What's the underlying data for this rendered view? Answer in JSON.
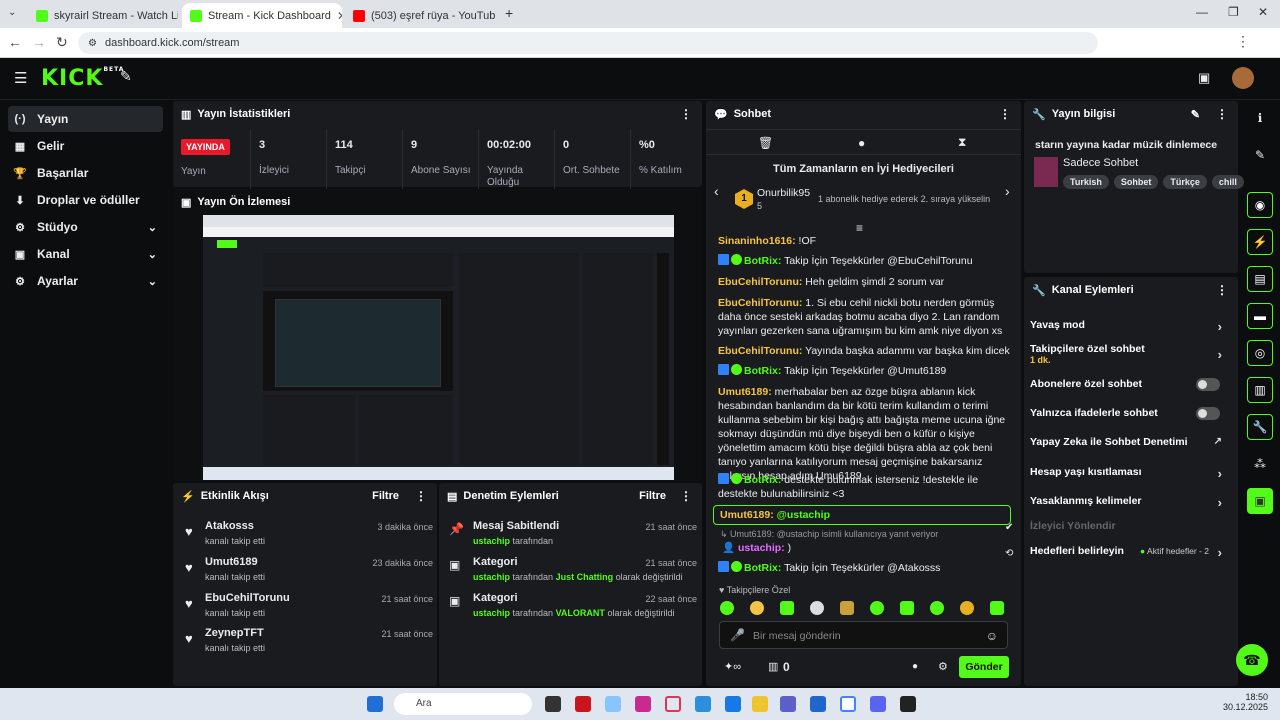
{
  "browser": {
    "tabs": [
      {
        "title": "skyrairl Stream - Watch Live on",
        "color": "#53fc18"
      },
      {
        "title": "Stream - Kick Dashboard",
        "color": "#53fc18"
      },
      {
        "title": "(503) eşref rüya - YouTube",
        "color": "#ff0000"
      }
    ],
    "url": "dashboard.kick.com/stream"
  },
  "header": {
    "logo": "KICK",
    "beta": "BETA"
  },
  "sidebar": {
    "items": [
      {
        "label": "Yayın",
        "icon": "(·)"
      },
      {
        "label": "Gelir",
        "icon": "▦"
      },
      {
        "label": "Başarılar",
        "icon": "🏆"
      },
      {
        "label": "Droplar ve ödüller",
        "icon": "⬇"
      },
      {
        "label": "Stüdyo",
        "icon": "⚙"
      },
      {
        "label": "Kanal",
        "icon": "▣"
      },
      {
        "label": "Ayarlar",
        "icon": "⚙"
      }
    ]
  },
  "stats": {
    "title": "Yayın İstatistikleri",
    "live": "YAYINDA",
    "live_label": "Yayın",
    "items": [
      {
        "value": "3",
        "label": "İzleyici"
      },
      {
        "value": "114",
        "label": "Takipçi"
      },
      {
        "value": "9",
        "label": "Abone Sayısı"
      },
      {
        "value": "00:02:00",
        "label": "Yayında Olduğu"
      },
      {
        "value": "0",
        "label": "Ort. Sohbete"
      },
      {
        "value": "%0",
        "label": "% Katılım"
      }
    ]
  },
  "preview": {
    "title": "Yayın Ön İzlemesi"
  },
  "activity": {
    "title": "Etkinlik Akışı",
    "filter": "Filtre",
    "items": [
      {
        "name": "Atakosss",
        "sub": "kanalı takip etti",
        "time": "3 dakika önce"
      },
      {
        "name": "Umut6189",
        "sub": "kanalı takip etti",
        "time": "23 dakika önce"
      },
      {
        "name": "EbuCehilTorunu",
        "sub": "kanalı takip etti",
        "time": "21 saat önce"
      },
      {
        "name": "ZeynepTFT",
        "sub": "kanalı takip etti",
        "time": "21 saat önce"
      }
    ]
  },
  "moderation": {
    "title": "Denetim Eylemleri",
    "filter": "Filtre",
    "items": [
      {
        "name": "Mesaj Sabitlendi",
        "user": "ustachip",
        "text": "tarafından",
        "extra": "",
        "extra2": "",
        "time": "21 saat önce"
      },
      {
        "name": "Kategori",
        "user": "ustachip",
        "text": "tarafından",
        "extra": "Just Chatting",
        "extra2": "olarak değiştirildi",
        "time": "21 saat önce"
      },
      {
        "name": "Kategori",
        "user": "ustachip",
        "text": "tarafından",
        "extra": "VALORANT",
        "extra2": "olarak değiştirildi",
        "time": "22 saat önce"
      }
    ]
  },
  "chat": {
    "title": "Sohbet",
    "gifters_title": "Tüm Zamanların en İyi Hediyecileri",
    "gifter": {
      "name": "Onurbilik95",
      "count": "5",
      "rank": "1",
      "note": "1 abonelik hediye ederek 2. sıraya yükselin"
    },
    "messages": [
      {
        "user": "Sinaninho1616:",
        "text": " !OF",
        "color": "yel",
        "bot": false
      },
      {
        "user": "BotRix:",
        "text": " Takip İçin Teşekkürler @EbuCehilTorunu",
        "color": "grn",
        "bot": true
      },
      {
        "user": "EbuCehilTorunu:",
        "text": " Heh geldim şimdi 2 sorum var",
        "color": "yel",
        "bot": false
      },
      {
        "user": "EbuCehilTorunu:",
        "text": " 1. Si ebu cehil nickli botu nerden görmüş daha önce sesteki arkadaş botmu acaba diyo 2. Lan random yayınları gezerken sana uğramışım bu kim amk niye diyon xs",
        "color": "yel",
        "bot": false
      },
      {
        "user": "EbuCehilTorunu:",
        "text": " Yayında başka adammı var başka kim dicek",
        "color": "yel",
        "bot": false
      },
      {
        "user": "BotRix:",
        "text": " Takip İçin Teşekkürler @Umut6189",
        "color": "grn",
        "bot": true
      },
      {
        "user": "Umut6189:",
        "text": " merhabalar ben az özge büşra ablanın kick hesabından banlandım da bir kötü terim kullandım o terimi kullanma sebebim bir kişi bağış attı bağışta meme ucuna iğne sokmayı düşündün mü diye bişeydi ben o küfür o kişiye yönelettim amacım kötü bişe değildi büşra abla az çok beni tanıyo yanlarına katılıyorum mesaj geçmişine bakarsanız anlarsın hesap adım Umu6189",
        "color": "yel",
        "bot": false
      },
      {
        "user": "BotRix:",
        "text": " destekte bulunmak isterseniz !destekle ile destekte bulunabilirsiniz <3",
        "color": "grn",
        "bot": true
      }
    ],
    "pinned": {
      "user": "Umut6189:",
      "text": " @ustachip"
    },
    "reply_note": "Umut6189: @ustachip isimli kullanıcıya yanıt veriyor",
    "reply": {
      "user": "ustachip:",
      "text": " )"
    },
    "last": {
      "user": "BotRix:",
      "text": " Takip İçin Teşekkürler @Atakosss"
    },
    "emote_label": "Takipçilere Özel",
    "placeholder": "Bir mesaj gönderin",
    "count": "0",
    "send": "Gönder"
  },
  "info": {
    "title": "Yayın bilgisi",
    "stream_title": "starın yayına kadar müzik dinlemece",
    "category": "Sadece Sohbet",
    "tags": [
      "Turkish",
      "Sohbet",
      "Türkçe",
      "chill"
    ]
  },
  "channel_actions": {
    "title": "Kanal Eylemleri",
    "items": [
      {
        "label": "Yavaş mod",
        "sub": "",
        "kind": "chev"
      },
      {
        "label": "Takipçilere özel sohbet",
        "sub": "1 dk.",
        "kind": "chev"
      },
      {
        "label": "Abonelere özel sohbet",
        "sub": "",
        "kind": "toggle"
      },
      {
        "label": "Yalnızca ifadelerle sohbet",
        "sub": "",
        "kind": "toggle"
      },
      {
        "label": "Yapay Zeka ile Sohbet Denetimi",
        "sub": "",
        "kind": "ext"
      },
      {
        "label": "Hesap yaşı kısıtlaması",
        "sub": "",
        "kind": "chev"
      },
      {
        "label": "Yasaklanmış kelimeler",
        "sub": "",
        "kind": "chev"
      },
      {
        "label": "İzleyici Yönlendir",
        "sub": "",
        "kind": "none"
      },
      {
        "label": "Hedefleri belirleyin",
        "sub": "Aktif hedefler - 2",
        "kind": "chev"
      }
    ]
  },
  "taskbar": {
    "search": "Ara",
    "time": "18:50",
    "date": "30.12.2025"
  }
}
